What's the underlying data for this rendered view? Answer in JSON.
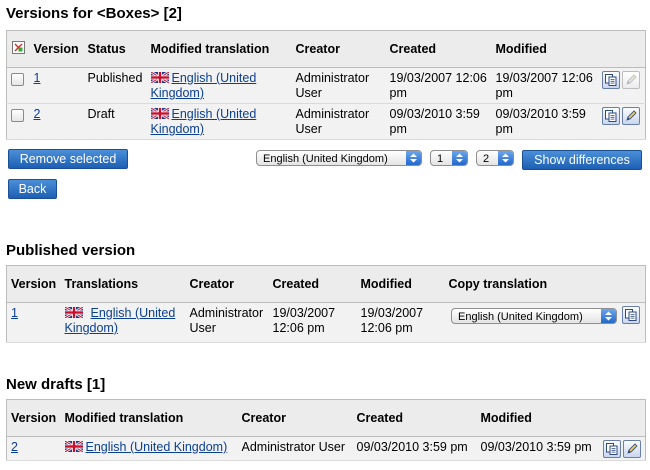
{
  "versions": {
    "title": "Versions for <Boxes> [2]",
    "headers": [
      "Version",
      "Status",
      "Modified translation",
      "Creator",
      "Created",
      "Modified"
    ],
    "rows": [
      {
        "version": "1",
        "status": "Published",
        "translation": "English (United Kingdom)",
        "creator": "Administrator User",
        "created": "19/03/2007 12:06 pm",
        "modified": "19/03/2007 12:06 pm"
      },
      {
        "version": "2",
        "status": "Draft",
        "translation": "English (United Kingdom)",
        "creator": "Administrator User",
        "created": "09/03/2010 3:59 pm",
        "modified": "09/03/2010 3:59 pm"
      }
    ],
    "remove_label": "Remove selected",
    "lang_select": "English (United Kingdom)",
    "from_select": "1",
    "to_select": "2",
    "diff_label": "Show differences",
    "back_label": "Back"
  },
  "published": {
    "title": "Published version",
    "headers": [
      "Version",
      "Translations",
      "Creator",
      "Created",
      "Modified",
      "Copy translation"
    ],
    "row": {
      "version": "1",
      "translation": "English (United Kingdom)",
      "creator": "Administrator User",
      "created": "19/03/2007 12:06 pm",
      "modified": "19/03/2007 12:06 pm",
      "copy_select": "English (United Kingdom)"
    }
  },
  "drafts": {
    "title": "New drafts [1]",
    "headers": [
      "Version",
      "Modified translation",
      "Creator",
      "Created",
      "Modified"
    ],
    "row": {
      "version": "2",
      "translation": "English (United Kingdom)",
      "creator": "Administrator User",
      "created": "09/03/2010 3:59 pm",
      "modified": "09/03/2010 3:59 pm"
    }
  },
  "colors": {
    "accent": "#2a6fcf",
    "link": "#0b3f94",
    "header_bg": "#ececec"
  }
}
